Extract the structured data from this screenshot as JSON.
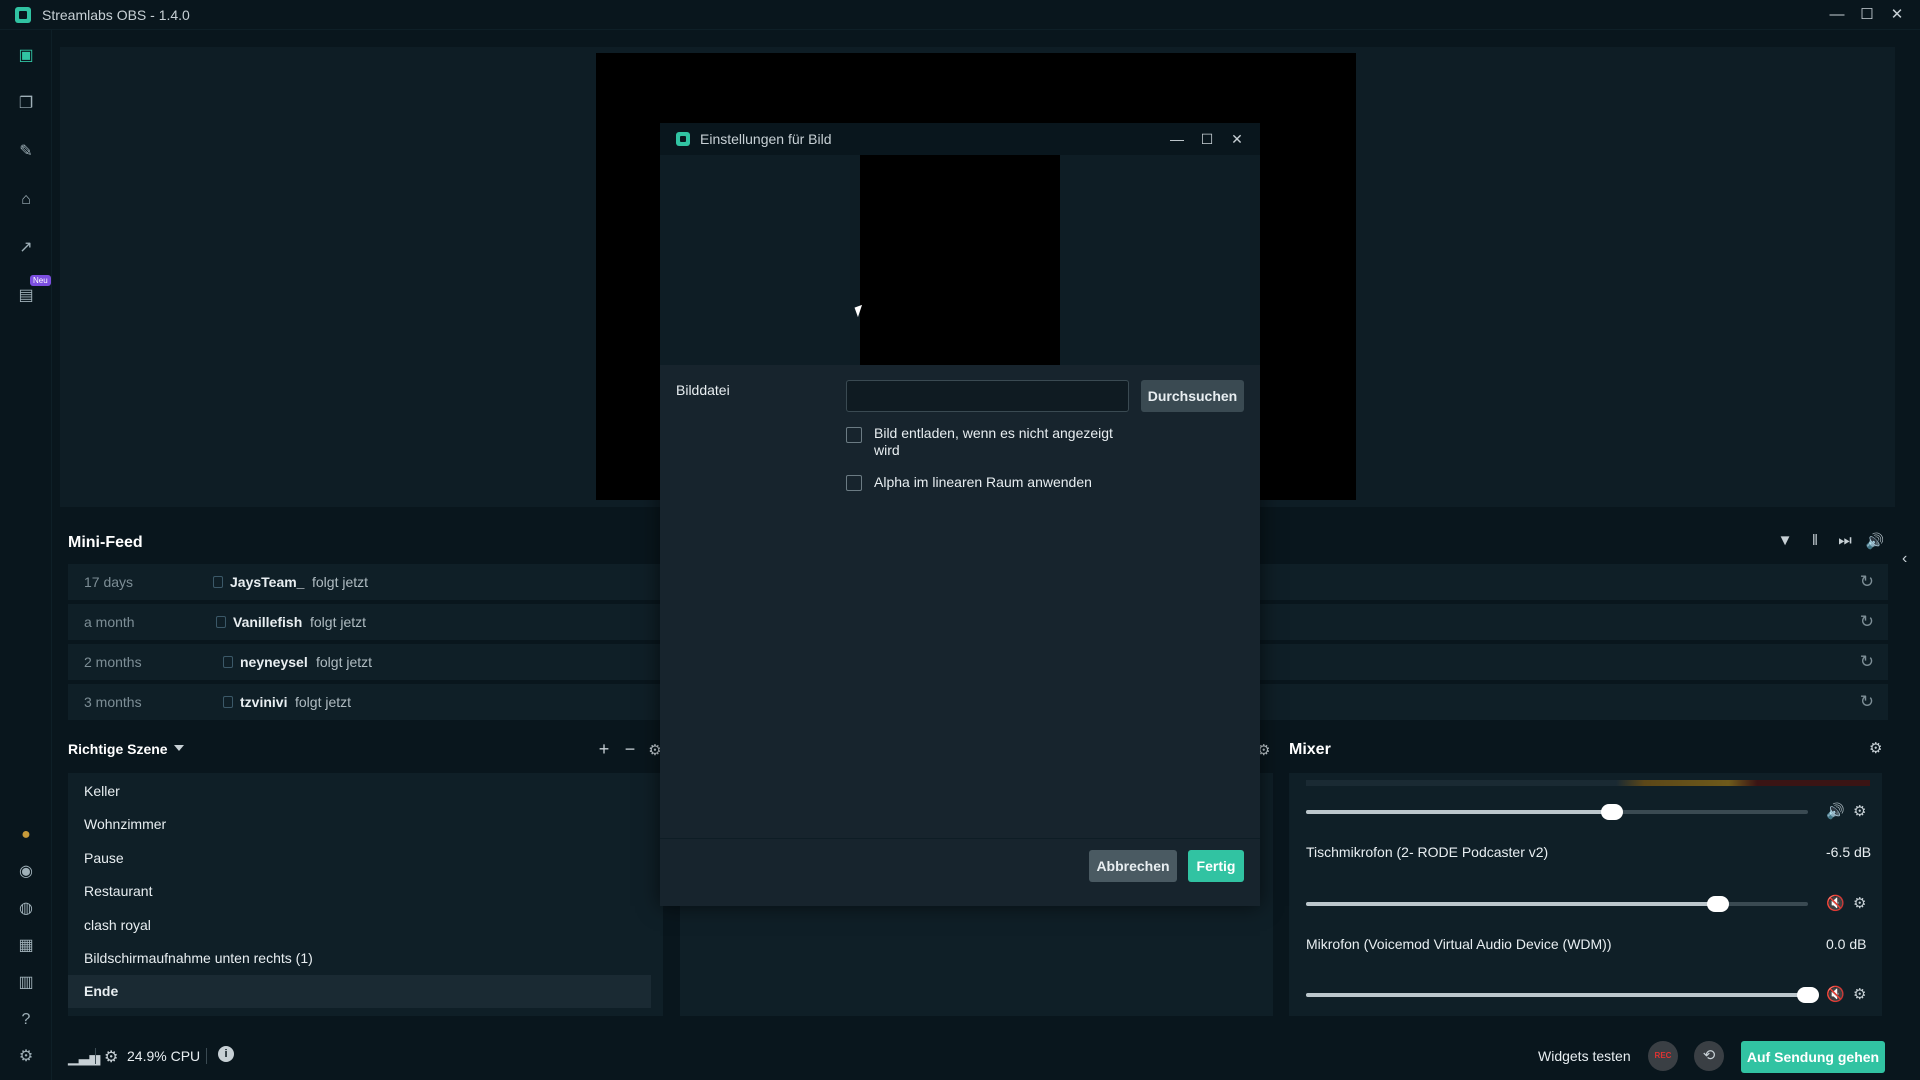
{
  "app": {
    "title": "Streamlabs OBS - 1.4.0"
  },
  "window_controls": {
    "minimize": "—",
    "maximize": "☐",
    "close": "✕"
  },
  "nav": {
    "neu_badge": "Neu"
  },
  "minifeed": {
    "title": "Mini-Feed",
    "items": [
      {
        "time": "17 days",
        "user": "JaysTeam_",
        "action": "folgt jetzt"
      },
      {
        "time": "a month",
        "user": "Vanillefish",
        "action": "folgt jetzt"
      },
      {
        "time": "2 months",
        "user": "neyneysel",
        "action": "folgt jetzt"
      },
      {
        "time": "3 months",
        "user": "tzvinivi",
        "action": "folgt jetzt"
      }
    ]
  },
  "scenes": {
    "title": "Richtige Szene",
    "items": [
      "Keller",
      "Wohnzimmer",
      "Pause",
      "Restaurant",
      "clash royal",
      "Bildschirmaufnahme unten rechts (1)",
      "Ende"
    ],
    "selected_index": 6
  },
  "mixer": {
    "title": "Mixer",
    "channels": [
      {
        "name": "",
        "db": "",
        "level": 0.61,
        "muted": false
      },
      {
        "name": "Tischmikrofon (2- RODE Podcaster v2)",
        "db": "-6.5 dB",
        "level": 0.82,
        "muted": true
      },
      {
        "name": "Mikrofon (Voicemod Virtual Audio Device (WDM))",
        "db": "0.0 dB",
        "level": 1.0,
        "muted": true
      }
    ]
  },
  "footer": {
    "cpu": "24.9% CPU",
    "widgets_test": "Widgets testen",
    "rec": "REC",
    "go_live": "Auf Sendung gehen"
  },
  "modal": {
    "title": "Einstellungen für Bild",
    "field_label": "Bilddatei",
    "file_value": "",
    "browse": "Durchsuchen",
    "checkbox1": "Bild entladen, wenn es nicht angezeigt wird",
    "checkbox2": "Alpha im linearen Raum anwenden",
    "cancel": "Abbrechen",
    "done": "Fertig"
  },
  "colors": {
    "accent": "#31c3a2",
    "background": "#09161d",
    "panel": "#0f1f27"
  }
}
